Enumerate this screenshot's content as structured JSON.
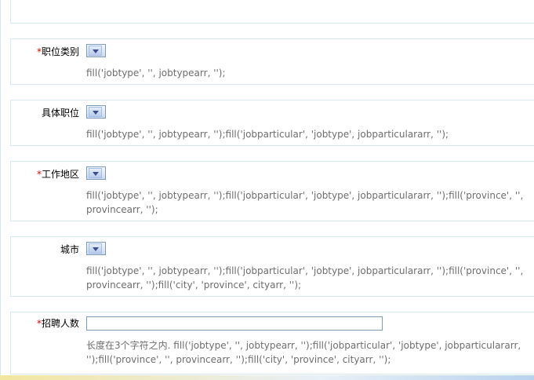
{
  "form": {
    "fields": [
      {
        "label": "职位类别",
        "required": true,
        "control": "select",
        "selected": "",
        "hint": "fill('jobtype', '', jobtypearr, '');"
      },
      {
        "label": "具体职位",
        "required": false,
        "control": "select",
        "selected": "",
        "hint": "fill('jobtype', '', jobtypearr, '');fill('jobparticular', 'jobtype', jobparticulararr, '');"
      },
      {
        "label": "工作地区",
        "required": true,
        "control": "select",
        "selected": "",
        "hint": "fill('jobtype', '', jobtypearr, '');fill('jobparticular', 'jobtype', jobparticulararr, '');fill('province', '',\nprovincearr, '');"
      },
      {
        "label": "城市",
        "required": false,
        "control": "select",
        "selected": "",
        "hint": "fill('jobtype', '', jobtypearr, '');fill('jobparticular', 'jobtype', jobparticulararr, '');fill('province', '',\nprovincearr, '');fill('city', 'province', cityarr, '');"
      },
      {
        "label": "招聘人数",
        "required": true,
        "control": "text",
        "value": "",
        "hint": "长度在3个字符之内. fill('jobtype', '', jobtypearr, '');fill('jobparticular', 'jobtype', jobparticulararr,\n'');fill('province', '', provincearr, '');fill('city', 'province', cityarr, '');"
      }
    ],
    "required_mark": "*"
  },
  "colors": {
    "required": "#e00000",
    "hint": "#6e6e6e",
    "panel_border": "#d6eaf0"
  }
}
